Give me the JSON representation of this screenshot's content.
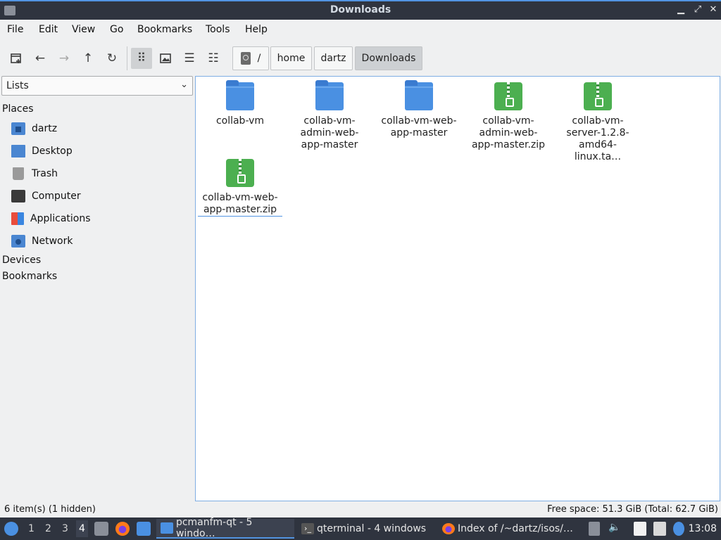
{
  "window": {
    "title": "Downloads",
    "controls": {
      "minimize": "▁",
      "restore": "⤢",
      "close": "✕"
    }
  },
  "menu": [
    "File",
    "Edit",
    "View",
    "Go",
    "Bookmarks",
    "Tools",
    "Help"
  ],
  "toolbar": {
    "icons": [
      "new-tab-icon",
      "back-icon",
      "forward-icon",
      "up-icon",
      "reload-icon",
      "icon-view-icon",
      "thumbnail-view-icon",
      "compact-view-icon",
      "detailed-list-icon"
    ],
    "glyphs": {
      "back": "←",
      "forward": "→",
      "up": "↑",
      "reload": "↻",
      "icon_view": "⠿",
      "compact": "☰",
      "detailed": "☷"
    }
  },
  "breadcrumb": [
    "/",
    "home",
    "dartz",
    "Downloads"
  ],
  "sidebar": {
    "mode": "Lists",
    "places_header": "Places",
    "places": [
      {
        "label": "dartz",
        "icon": "home-folder-icon"
      },
      {
        "label": "Desktop",
        "icon": "desktop-icon"
      },
      {
        "label": "Trash",
        "icon": "trash-icon"
      },
      {
        "label": "Computer",
        "icon": "computer-icon"
      },
      {
        "label": "Applications",
        "icon": "applications-icon"
      },
      {
        "label": "Network",
        "icon": "network-icon"
      }
    ],
    "devices_header": "Devices",
    "bookmarks_header": "Bookmarks"
  },
  "files": [
    {
      "name": "collab-vm",
      "type": "folder"
    },
    {
      "name": "collab-vm-admin-web-app-master",
      "type": "folder"
    },
    {
      "name": "collab-vm-web-app-master",
      "type": "folder"
    },
    {
      "name": "collab-vm-admin-web-app-master.zip",
      "type": "zip"
    },
    {
      "name": "collab-vm-server-1.2.8-amd64-linux.ta…",
      "type": "zip"
    },
    {
      "name": "collab-vm-web-app-master.zip",
      "type": "zip"
    }
  ],
  "status": {
    "items": "6 item(s) (1 hidden)",
    "free_space": "Free space: 51.3 GiB (Total: 62.7 GiB)"
  },
  "taskbar": {
    "workspaces": [
      "1",
      "2",
      "3",
      "4"
    ],
    "active_workspace": "4",
    "tasks": [
      {
        "label": "pcmanfm-qt - 5 windo…",
        "icon": "folder-icon"
      },
      {
        "label": "qterminal - 4 windows",
        "icon": "terminal-icon"
      },
      {
        "label": "Index of /~dartz/isos/…",
        "icon": "firefox-icon"
      }
    ],
    "clock": "13:08"
  },
  "colors": {
    "accent": "#5294e2",
    "folder": "#4a90e2",
    "zip": "#4caf50",
    "panel": "#2f343f"
  }
}
